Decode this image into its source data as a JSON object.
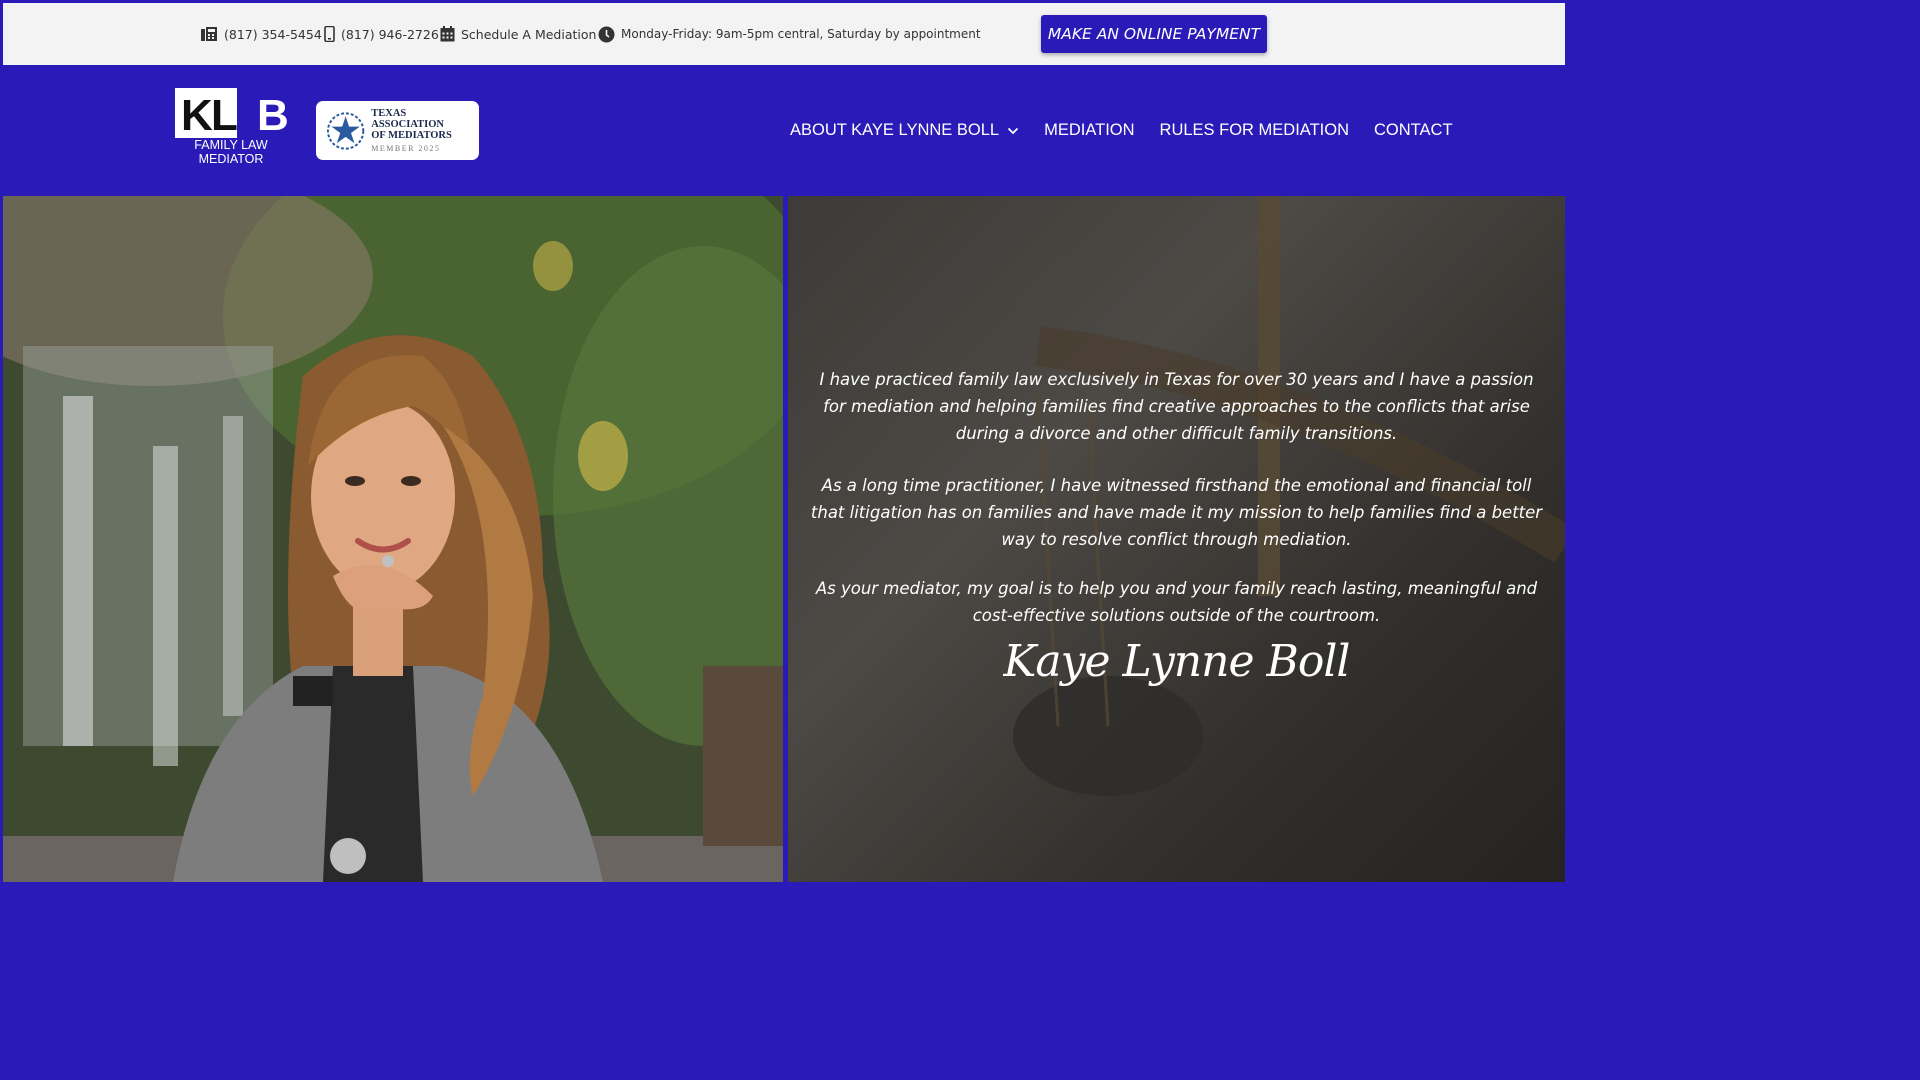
{
  "topbar": {
    "phone_office": "(817) 354-5454",
    "phone_mobile": "(817) 946-2726",
    "schedule": "Schedule A Mediation",
    "hours_line1": "Monday-Friday: 9am-5pm central,",
    "hours_line2": "Saturday by appointment",
    "payment_button": "MAKE AN ONLINE PAYMENT"
  },
  "logo": {
    "letters": "KLB",
    "sub_line1": "FAMILY LAW",
    "sub_line2": "MEDIATOR"
  },
  "badge": {
    "line1": "TEXAS ASSOCIATION",
    "line2": "OF MEDIATORS",
    "line3": "MEMBER 2025"
  },
  "nav": {
    "items": [
      {
        "label": "ABOUT KAYE LYNNE BOLL"
      },
      {
        "label": "MEDIATION"
      },
      {
        "label": "RULES FOR MEDIATION"
      },
      {
        "label": "CONTACT"
      }
    ]
  },
  "hero": {
    "paragraphs": [
      "I have practiced family law exclusively in Texas for over 30 years and I have a passion for mediation and helping families find creative approaches to the conflicts that arise during a divorce and other difficult family transitions.",
      "As a long time practitioner, I have witnessed firsthand the emotional and financial toll that litigation has on families and have made it my mission to help families find a better way to resolve conflict through mediation.",
      "As your mediator, my goal is to help you and your family reach lasting, meaningful and cost-effective solutions outside of the courtroom."
    ],
    "signature": "Kaye Lynne Boll"
  },
  "colors": {
    "brand": "#2a1ab8",
    "topbar_bg": "#f3f3f3"
  }
}
